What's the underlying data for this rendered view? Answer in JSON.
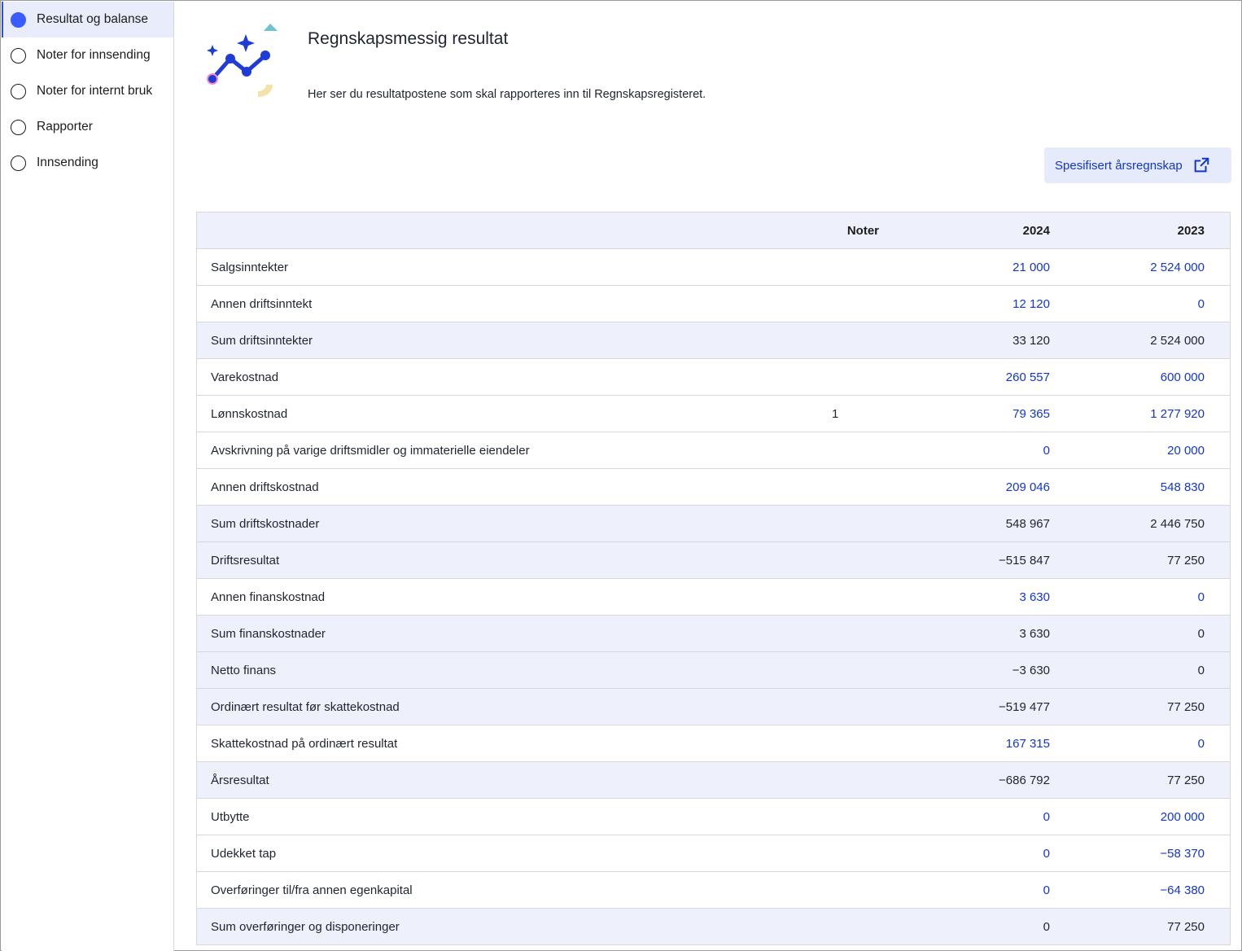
{
  "sidebar": {
    "items": [
      {
        "label": "Resultat og balanse",
        "active": true
      },
      {
        "label": "Noter for innsending",
        "active": false
      },
      {
        "label": "Noter for internt bruk",
        "active": false
      },
      {
        "label": "Rapporter",
        "active": false
      },
      {
        "label": "Innsending",
        "active": false
      }
    ]
  },
  "header": {
    "title": "Regnskapsmessig resultat",
    "description": "Her ser du resultatpostene som skal rapporteres inn til Regnskapsregisteret.",
    "spec_button_label": "Spesifisert årsregnskap",
    "spec_button_icon": "external-link-icon"
  },
  "table": {
    "columns": [
      "",
      "Noter",
      "2024",
      "2023"
    ],
    "rows": [
      {
        "label": "Salgsinntekter",
        "note": "",
        "y2024": "21 000",
        "y2023": "2 524 000",
        "editable": true,
        "sum": false
      },
      {
        "label": "Annen driftsinntekt",
        "note": "",
        "y2024": "12 120",
        "y2023": "0",
        "editable": true,
        "sum": false
      },
      {
        "label": "Sum driftsinntekter",
        "note": "",
        "y2024": "33 120",
        "y2023": "2 524 000",
        "editable": false,
        "sum": true
      },
      {
        "label": "Varekostnad",
        "note": "",
        "y2024": "260 557",
        "y2023": "600 000",
        "editable": true,
        "sum": false
      },
      {
        "label": "Lønnskostnad",
        "note": "1",
        "y2024": "79 365",
        "y2023": "1 277 920",
        "editable": true,
        "sum": false
      },
      {
        "label": "Avskrivning på varige driftsmidler og immaterielle eiendeler",
        "note": "",
        "y2024": "0",
        "y2023": "20 000",
        "editable": true,
        "sum": false
      },
      {
        "label": "Annen driftskostnad",
        "note": "",
        "y2024": "209 046",
        "y2023": "548 830",
        "editable": true,
        "sum": false
      },
      {
        "label": "Sum driftskostnader",
        "note": "",
        "y2024": "548 967",
        "y2023": "2 446 750",
        "editable": false,
        "sum": true
      },
      {
        "label": "Driftsresultat",
        "note": "",
        "y2024": "−515 847",
        "y2023": "77 250",
        "editable": false,
        "sum": true
      },
      {
        "label": "Annen finanskostnad",
        "note": "",
        "y2024": "3 630",
        "y2023": "0",
        "editable": true,
        "sum": false
      },
      {
        "label": "Sum finanskostnader",
        "note": "",
        "y2024": "3 630",
        "y2023": "0",
        "editable": false,
        "sum": true
      },
      {
        "label": "Netto finans",
        "note": "",
        "y2024": "−3 630",
        "y2023": "0",
        "editable": false,
        "sum": true
      },
      {
        "label": "Ordinært resultat før skattekostnad",
        "note": "",
        "y2024": "−519 477",
        "y2023": "77 250",
        "editable": false,
        "sum": true
      },
      {
        "label": "Skattekostnad på ordinært resultat",
        "note": "",
        "y2024": "167 315",
        "y2023": "0",
        "editable": true,
        "sum": false
      },
      {
        "label": "Årsresultat",
        "note": "",
        "y2024": "−686 792",
        "y2023": "77 250",
        "editable": false,
        "sum": true
      },
      {
        "label": "Utbytte",
        "note": "",
        "y2024": "0",
        "y2023": "200 000",
        "editable": true,
        "sum": false
      },
      {
        "label": "Udekket tap",
        "note": "",
        "y2024": "0",
        "y2023": "−58 370",
        "editable": true,
        "sum": false
      },
      {
        "label": "Overføringer til/fra annen egenkapital",
        "note": "",
        "y2024": "0",
        "y2023": "−64 380",
        "editable": true,
        "sum": false
      },
      {
        "label": "Sum overføringer og disponeringer",
        "note": "",
        "y2024": "0",
        "y2023": "77 250",
        "editable": false,
        "sum": true
      }
    ]
  },
  "colors": {
    "accent": "#1336cf",
    "active_radio": "#3b5cff",
    "sum_row_bg": "#eef1fc"
  }
}
